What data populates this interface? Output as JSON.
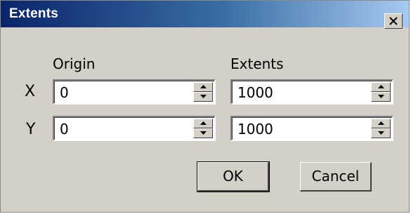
{
  "window": {
    "title": "Extents"
  },
  "labels": {
    "origin": "Origin",
    "extents": "Extents",
    "x": "X",
    "y": "Y"
  },
  "fields": {
    "x_origin": "0",
    "x_extents": "1000",
    "y_origin": "0",
    "y_extents": "1000"
  },
  "buttons": {
    "ok": "OK",
    "cancel": "Cancel"
  },
  "icons": {
    "close": "close-icon",
    "spin_up": "triangle-up-icon",
    "spin_down": "triangle-down-icon"
  },
  "colors": {
    "titlebar_start": "#0a246a",
    "titlebar_end": "#a6caf0",
    "dialog_face": "#d4d0c8"
  }
}
